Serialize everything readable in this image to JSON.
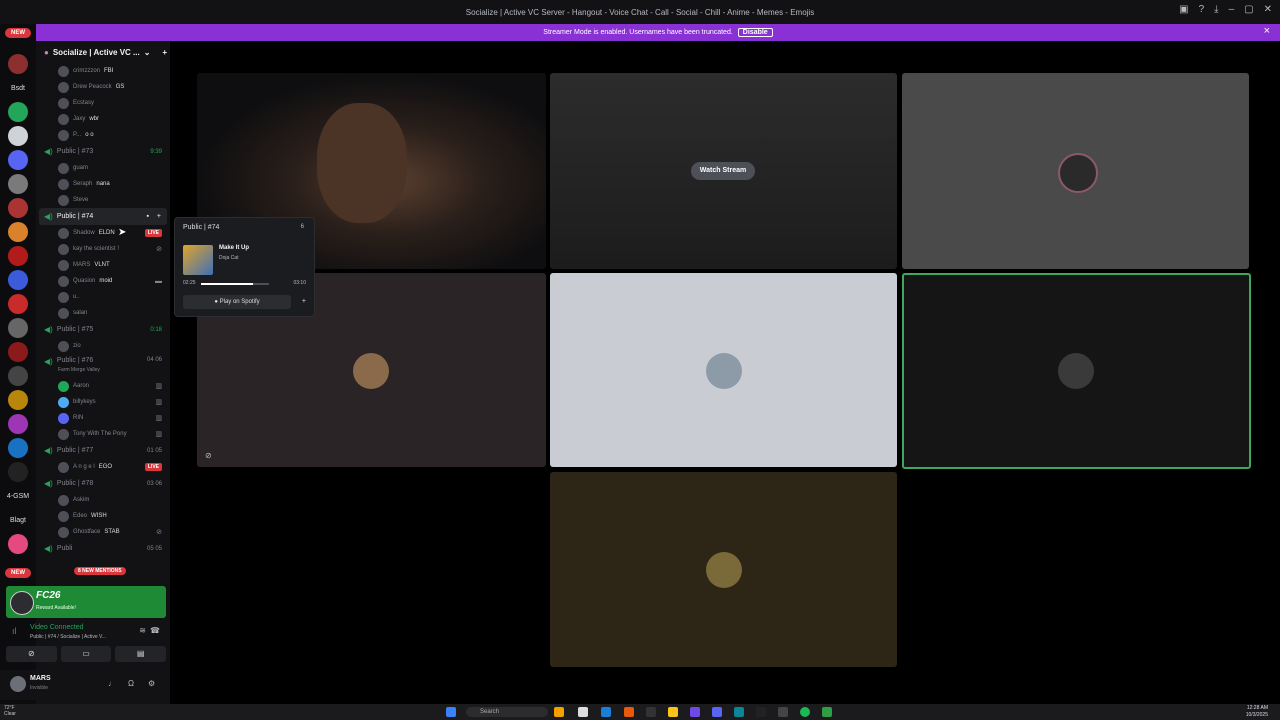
{
  "window": {
    "title": "Socialize | Active VC Server - Hangout - Voice Chat - Call - Social - Chill - Anime - Memes - Emojis"
  },
  "banner": {
    "text": "Streamer Mode is enabled. Usernames have been truncated.",
    "disable_label": "Disable"
  },
  "server_rail": {
    "new_top": "NEW",
    "new_bottom": "NEW",
    "labels": [
      "Bsdt",
      "4-GSM",
      "Blagt"
    ]
  },
  "server": {
    "name": "Socialize | Active VC ..."
  },
  "channels": [
    {
      "name": "Public | #73",
      "count": "9:39",
      "members": [
        "guam",
        "Seraph",
        "Steve"
      ]
    },
    {
      "name": "Public | #74",
      "members": [
        "Shadow",
        "kay the scientist !",
        "MARS",
        "Quasion",
        "u..",
        "salan"
      ]
    },
    {
      "name": "Public | #75",
      "count": "0:18",
      "members": [
        "zio"
      ]
    },
    {
      "name": "Public | #76",
      "subtitle": "Farm Merge Valley",
      "count": "04 06",
      "members": [
        "Aaron",
        "billykeys",
        "RIN",
        "Tony With The Pony"
      ]
    },
    {
      "name": "Public | #77",
      "count": "01 05",
      "members": [
        "A n g e l"
      ]
    },
    {
      "name": "Public | #78",
      "count": "03 06",
      "members": [
        "Askim",
        "Edeo",
        "Ghostface"
      ]
    },
    {
      "name": "Publi",
      "count": "05 05"
    }
  ],
  "top_members": [
    "crimzzzon",
    "Drew Peacock",
    "Ecstasy",
    "Jaxy",
    "P..."
  ],
  "member_tags": {
    "crimzzzon": "FBI",
    "Drew Peacock": "GS",
    "Jaxy": "wbr",
    "P...": "o o",
    "Seraph": "nana",
    "Shadow": "ELDN",
    "MARS": "VLNT",
    "Quasion": "moid",
    "A n g e l": "EGO",
    "Edeo": "WISH",
    "Ghostface": "STAB"
  },
  "live_label": "LIVE",
  "new_mentions": "8 NEW MENTIONS",
  "promo": {
    "title": "FC26",
    "subtitle": "Reward Available!"
  },
  "voice": {
    "status": "Video Connected",
    "location": "Public | #74 / Socialize | Active V..."
  },
  "user": {
    "name": "MARS",
    "status": "Invisible"
  },
  "popup": {
    "channel": "Public | #74",
    "count": "6",
    "song": "Make It Up",
    "artist": "Doja Cat",
    "elapsed": "02:25",
    "duration": "03:10",
    "progress": 0.76,
    "play_label": "Play on Spotify"
  },
  "stream": {
    "watch_label": "Watch Stream"
  },
  "taskbar": {
    "weather": "72°F",
    "weather_sub": "Clear",
    "search_placeholder": "Search",
    "time": "12:28 AM",
    "date": "10/3/2025"
  },
  "colors": {
    "accent_purple": "#8a31d6",
    "voice_green": "#23a55a",
    "live_red": "#da373c",
    "promo_green": "#1f8a35",
    "speaking_border": "#3fa85c"
  }
}
